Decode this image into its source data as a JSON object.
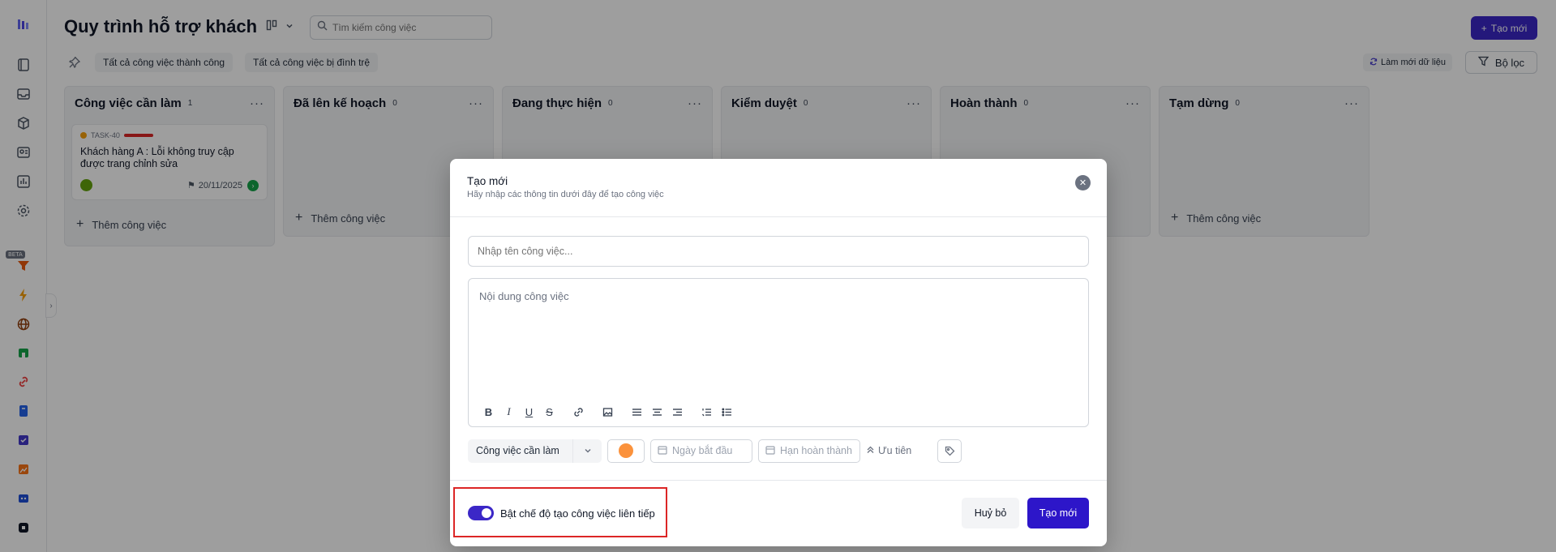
{
  "board": {
    "title": "Quy trình hỗ trợ khách",
    "search_placeholder": "Tìm kiếm công việc",
    "create_label": "Tạo mới",
    "filter_chips": [
      "Tất cả công việc thành công",
      "Tất cả công việc bị đình trệ"
    ],
    "refresh_label": "Làm mới dữ liệu",
    "filter_label": "Bộ lọc",
    "add_task_label": "Thêm công việc",
    "beta_label": "BETA",
    "columns": [
      {
        "title": "Công việc cần làm",
        "count": "1"
      },
      {
        "title": "Đã lên kế hoạch",
        "count": "0"
      },
      {
        "title": "Đang thực hiện",
        "count": "0"
      },
      {
        "title": "Kiểm duyệt",
        "count": "0"
      },
      {
        "title": "Hoàn thành",
        "count": "0"
      },
      {
        "title": "Tạm dừng",
        "count": "0"
      }
    ],
    "task": {
      "id": "TASK-40",
      "title": "Khách hàng A : Lỗi không truy cập được trang chỉnh sửa",
      "due_date": "20/11/2025"
    }
  },
  "modal": {
    "title": "Tạo mới",
    "subtitle": "Hãy nhập các thông tin dưới đây để tạo công việc",
    "name_placeholder": "Nhập tên công việc...",
    "content_placeholder": "Nội dung công việc",
    "status_value": "Công việc cần làm",
    "start_date_placeholder": "Ngày bắt đầu",
    "due_date_placeholder": "Hạn hoàn thành",
    "priority_label": "Ưu tiên",
    "toggle_label": "Bật chế độ tạo công việc liên tiếp",
    "toggle_on": true,
    "cancel_label": "Huỷ bỏ",
    "submit_label": "Tạo mới"
  },
  "colors": {
    "accent": "#3b27c7",
    "highlight": "#dc2626"
  }
}
